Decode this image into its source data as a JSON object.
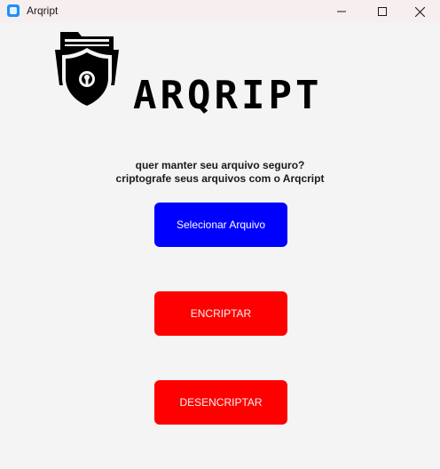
{
  "window": {
    "title": "Arqript",
    "controls": {
      "minimize": "minimize-icon",
      "maximize": "maximize-icon",
      "close": "close-icon"
    }
  },
  "logo": {
    "icon": "folder-lock-icon",
    "wordmark": "ARQRIPT"
  },
  "tagline": {
    "line1": "quer manter seu arquivo seguro?",
    "line2": "criptografe seus arquivos com o Arqcript"
  },
  "buttons": {
    "select_file": "Selecionar Arquivo",
    "encrypt": "ENCRIPTAR",
    "decrypt": "DESENCRIPTAR"
  },
  "colors": {
    "select_button": "#0000ff",
    "encrypt_button": "#ff0000",
    "decrypt_button": "#ff0000",
    "background": "#f4f4f4"
  }
}
